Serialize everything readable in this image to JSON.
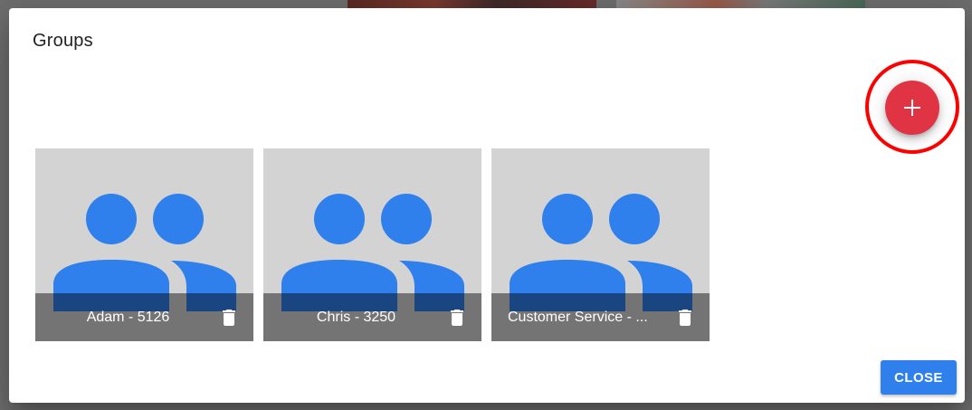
{
  "dialog": {
    "title": "Groups",
    "add_button_icon": "plus-icon",
    "close_label": "CLOSE"
  },
  "groups": [
    {
      "name": "Adam - 5126",
      "icon": "group-icon",
      "delete_icon": "trash-icon"
    },
    {
      "name": "Chris - 3250",
      "icon": "group-icon",
      "delete_icon": "trash-icon"
    },
    {
      "name": "Customer Service - ...",
      "icon": "group-icon",
      "delete_icon": "trash-icon"
    }
  ],
  "colors": {
    "fab": "#e03445",
    "highlight_ring": "#ff0000",
    "group_icon": "#2f80ec",
    "card_background": "#d3d3d3",
    "close_button": "#2f80ec"
  }
}
